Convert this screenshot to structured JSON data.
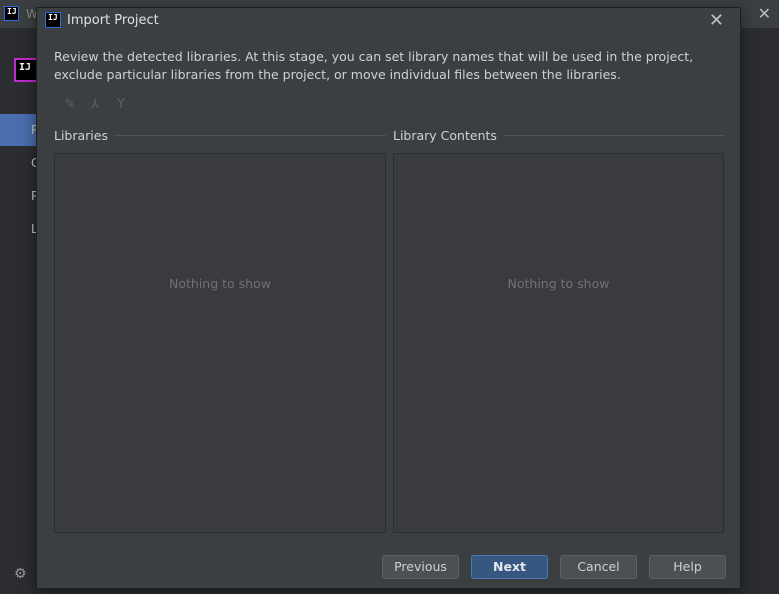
{
  "background": {
    "title": "W",
    "logo_text": "IJ",
    "nav_items": [
      "P",
      "C",
      "P",
      "L"
    ]
  },
  "dialog": {
    "title": "Import Project",
    "logo_text": "IJ",
    "close_symbol": "✕",
    "description": "Review the detected libraries. At this stage, you can set library names that will be used in the project, exclude particular libraries from the project, or move individual files between the libraries.",
    "toolbar": {
      "rename_icon": "✎",
      "merge_icon": "⅄",
      "split_icon": "Y"
    },
    "libraries_label": "Libraries",
    "library_contents_label": "Library Contents",
    "libraries_empty": "Nothing to show",
    "contents_empty": "Nothing to show",
    "buttons": {
      "previous": "Previous",
      "next": "Next",
      "cancel": "Cancel",
      "help": "Help"
    }
  },
  "colors": {
    "accent": "#4b6eaf",
    "primary_button": "#365880",
    "dialog_bg": "#3c3f41"
  }
}
